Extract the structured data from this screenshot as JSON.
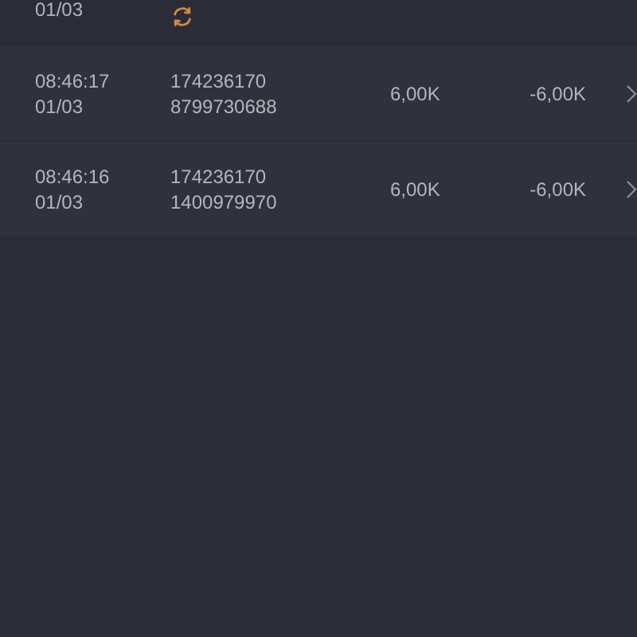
{
  "partial_row": {
    "date": "01/03",
    "pending": true
  },
  "transactions": [
    {
      "time": "08:46:17",
      "date": "01/03",
      "account": "174236170",
      "reference": "8799730688",
      "amount": "6,00K",
      "net": "-6,00K",
      "pending": false
    },
    {
      "time": "08:46:16",
      "date": "01/03",
      "account": "174236170",
      "reference": "1400979970",
      "amount": "6,00K",
      "net": "-6,00K",
      "pending": false
    }
  ]
}
